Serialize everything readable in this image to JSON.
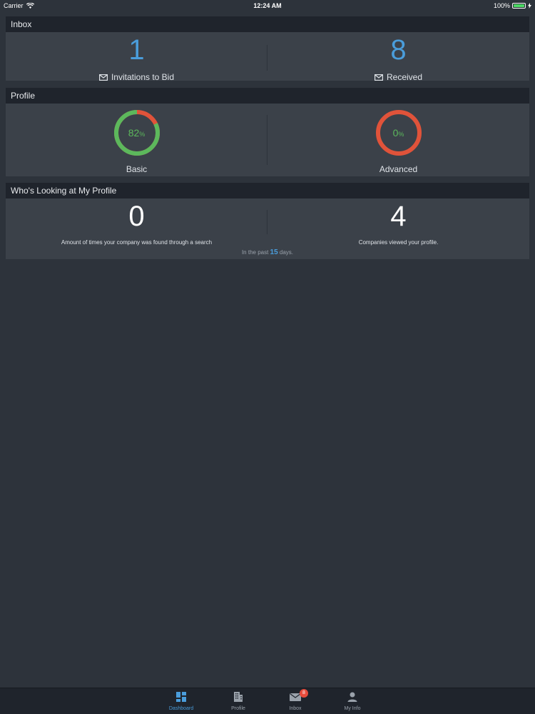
{
  "status_bar": {
    "carrier": "Carrier",
    "time": "12:24 AM",
    "battery": "100%"
  },
  "inbox": {
    "title": "Inbox",
    "invitations": {
      "count": "1",
      "label": "Invitations to Bid"
    },
    "received": {
      "count": "8",
      "label": "Received"
    }
  },
  "profile": {
    "title": "Profile",
    "basic": {
      "value": "82",
      "unit": "%",
      "label": "Basic",
      "fraction": 0.82
    },
    "advanced": {
      "value": "0",
      "unit": "%",
      "label": "Advanced",
      "fraction": 0
    }
  },
  "looking": {
    "title": "Who's Looking at My Profile",
    "searches": {
      "count": "0",
      "label": "Amount of times your company was found through a search"
    },
    "views": {
      "count": "4",
      "label": "Companies viewed your profile."
    },
    "footnote_prefix": "In the past",
    "footnote_days": "15",
    "footnote_suffix": "days."
  },
  "tab_bar": {
    "dashboard": "Dashboard",
    "profile": "Profile",
    "inbox": "Inbox",
    "inbox_badge": "8",
    "my_info": "My Info"
  },
  "colors": {
    "accent": "#4a9ddb",
    "progress_complete": "#5cb85c",
    "progress_remaining": "#e0533a",
    "badge": "#e74c3c"
  },
  "icons": [
    "wifi-icon",
    "battery-icon",
    "envelope-icon",
    "dashboard-icon",
    "building-icon",
    "mail-icon",
    "person-icon"
  ]
}
